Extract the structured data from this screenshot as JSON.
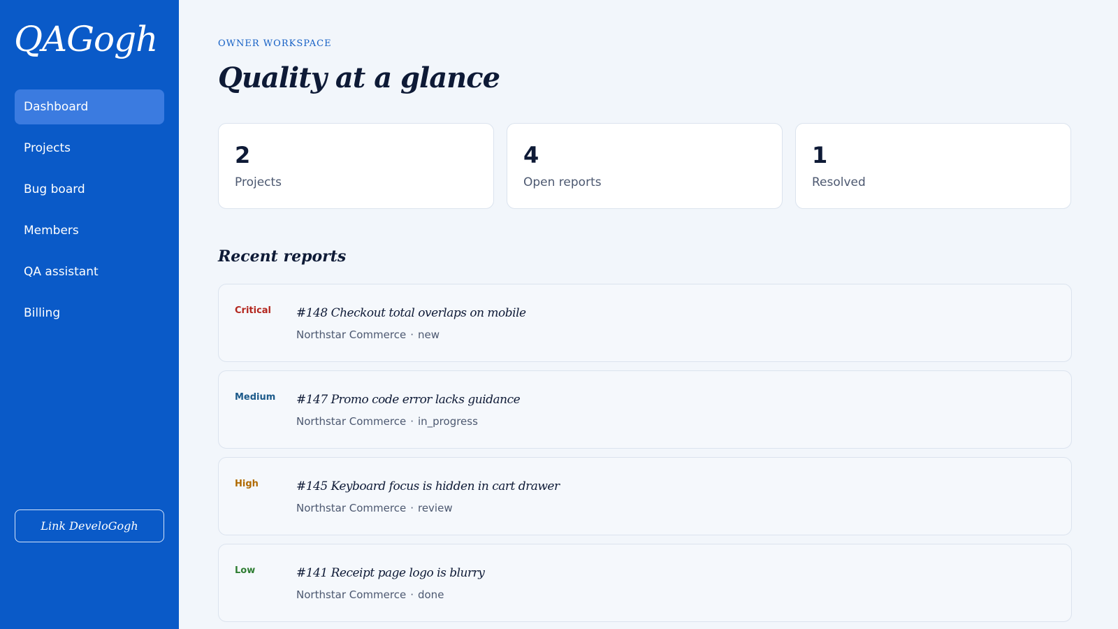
{
  "app": {
    "logo_text": "QAGogh"
  },
  "sidebar": {
    "items": [
      {
        "label": "Dashboard"
      },
      {
        "label": "Projects"
      },
      {
        "label": "Bug board"
      },
      {
        "label": "Members"
      },
      {
        "label": "QA assistant"
      },
      {
        "label": "Billing"
      }
    ],
    "active_item": "Dashboard",
    "link_button_label": "Link DeveloGogh"
  },
  "header": {
    "eyebrow": "OWNER WORKSPACE",
    "title": "Quality at a glance"
  },
  "stats": [
    {
      "value": "2",
      "label": "Projects"
    },
    {
      "value": "4",
      "label": "Open reports"
    },
    {
      "value": "1",
      "label": "Resolved"
    }
  ],
  "recent": {
    "title": "Recent reports",
    "separator": "·",
    "items": [
      {
        "severity": "Critical",
        "title": "#148 Checkout total overlaps on mobile",
        "project": "Northstar Commerce",
        "status": "new"
      },
      {
        "severity": "Medium",
        "title": "#147 Promo code error lacks guidance",
        "project": "Northstar Commerce",
        "status": "in_progress"
      },
      {
        "severity": "High",
        "title": "#145 Keyboard focus is hidden in cart drawer",
        "project": "Northstar Commerce",
        "status": "review"
      },
      {
        "severity": "Low",
        "title": "#141 Receipt page logo is blurry",
        "project": "Northstar Commerce",
        "status": "done"
      }
    ]
  },
  "colors": {
    "sidebar_bg": "#0a5ac8",
    "nav_active_bg": "#3b7be0",
    "page_bg": "#f2f6fb",
    "accent_text": "#1560c5",
    "severity_critical": "#b3261e",
    "severity_medium": "#1c5a8a",
    "severity_high": "#b06a00",
    "severity_low": "#2e7d32"
  }
}
